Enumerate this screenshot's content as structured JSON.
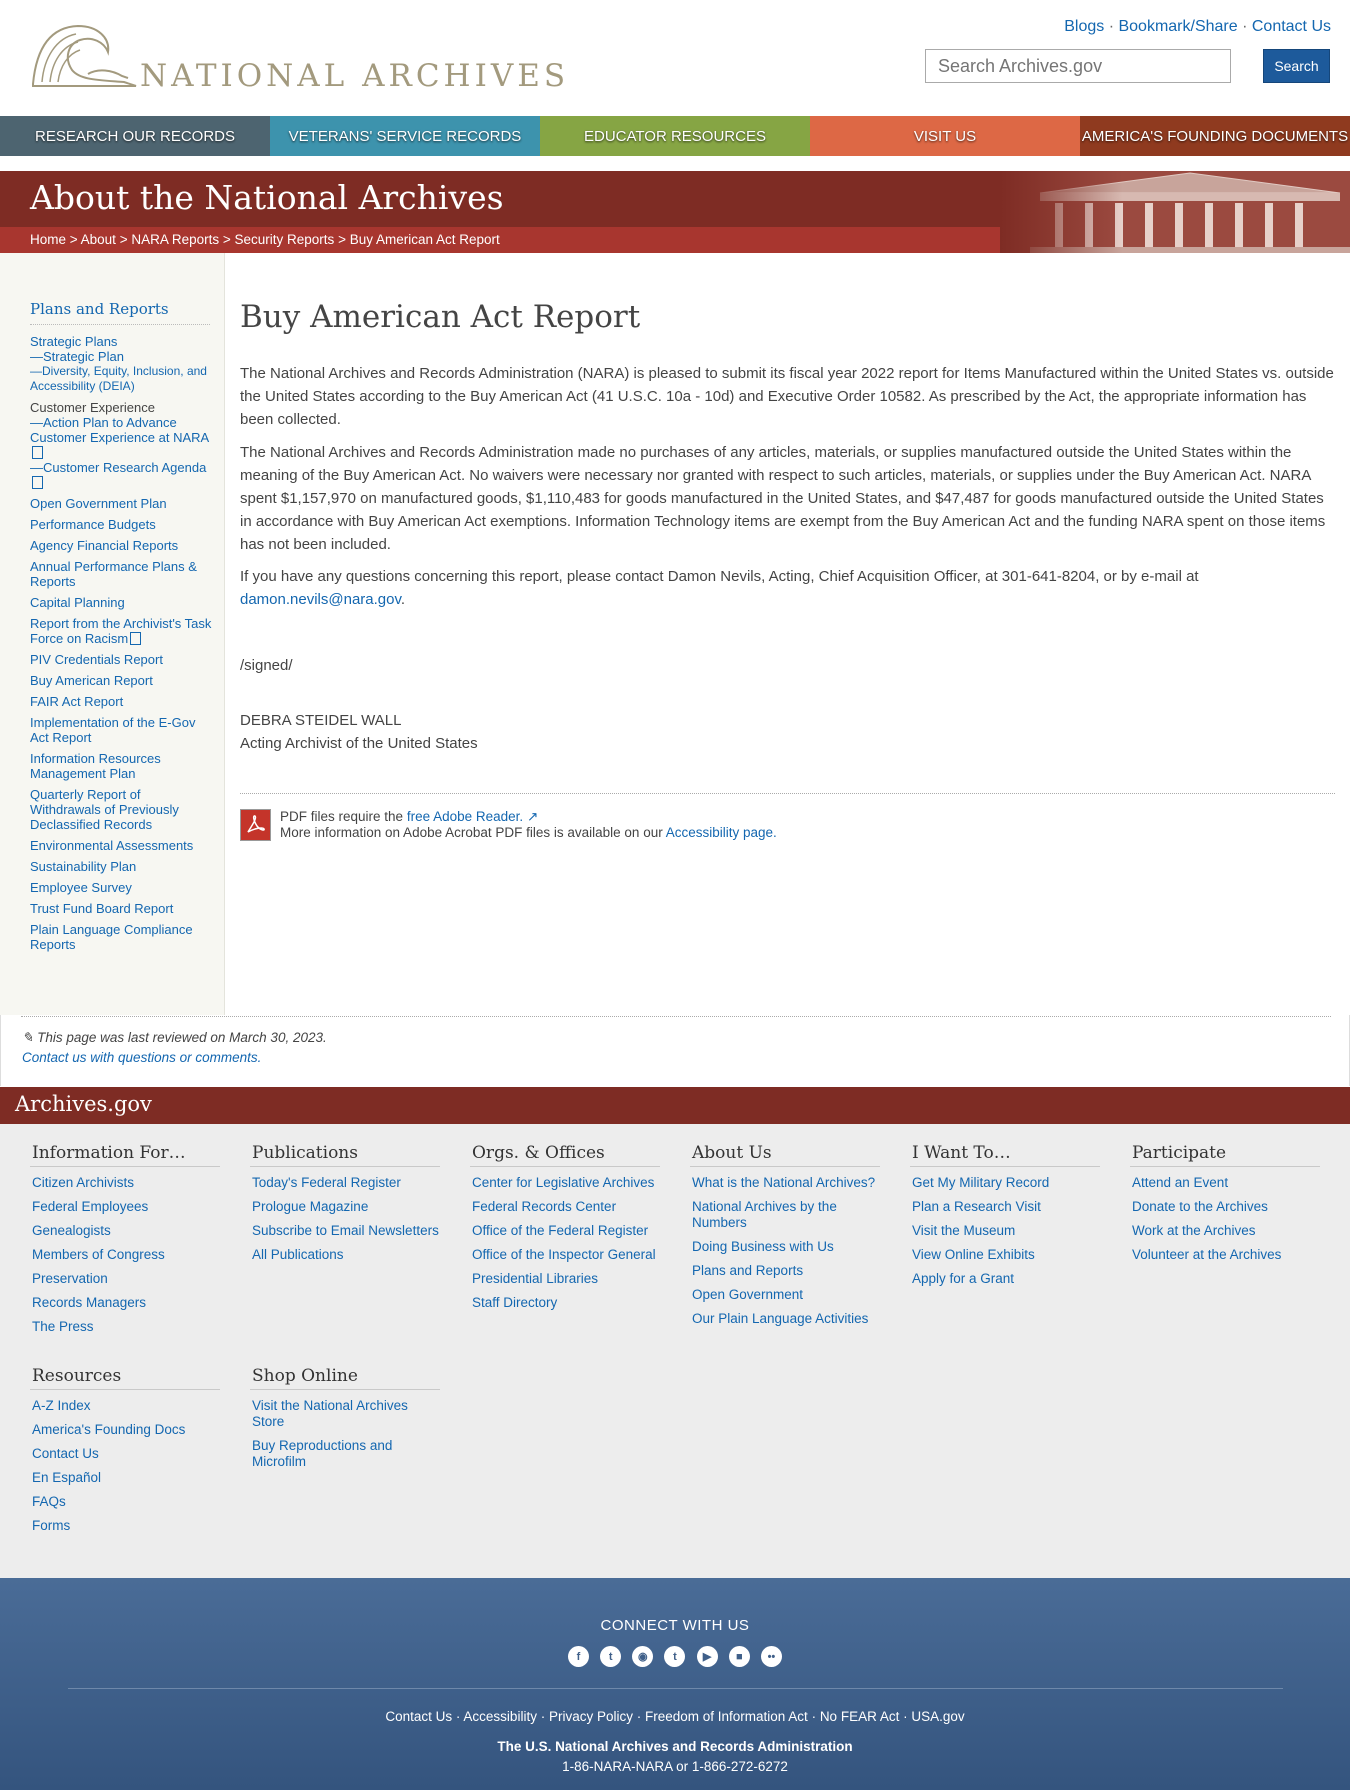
{
  "header": {
    "logo_text": "NATIONAL ARCHIVES",
    "top_links": [
      "Blogs",
      "Bookmark/Share",
      "Contact Us"
    ],
    "search_placeholder": "Search Archives.gov",
    "search_button": "Search"
  },
  "nav": [
    {
      "label": "RESEARCH OUR RECORDS",
      "color": "#4d6470"
    },
    {
      "label": "VETERANS' SERVICE RECORDS",
      "color": "#3d93ad"
    },
    {
      "label": "EDUCATOR RESOURCES",
      "color": "#86a544"
    },
    {
      "label": "VISIT US",
      "color": "#dd6845"
    },
    {
      "label": "AMERICA'S FOUNDING DOCUMENTS",
      "color": "#8f3a1f"
    }
  ],
  "banner": {
    "title": "About the National Archives",
    "breadcrumb": [
      "Home",
      "About",
      "NARA Reports",
      "Security Reports",
      "Buy American Act Report"
    ]
  },
  "sidebar": {
    "title": "Plans and Reports",
    "items": [
      "Strategic Plans",
      "—Strategic Plan",
      "—Diversity, Equity, Inclusion, and Accessibility (DEIA)",
      "Customer Experience",
      "—Action Plan to Advance Customer Experience at NARA",
      "—Customer Research Agenda",
      "Open Government Plan",
      "Performance Budgets",
      "Agency Financial Reports",
      "Annual Performance Plans & Reports",
      "Capital Planning",
      "Report from the Archivist's Task Force on Racism",
      "PIV Credentials Report",
      "Buy American Report",
      "FAIR Act Report",
      "Implementation of the E-Gov Act Report",
      "Information Resources Management Plan",
      "Quarterly Report of Withdrawals of Previously Declassified Records",
      "Environmental Assessments",
      "Sustainability Plan",
      "Employee Survey",
      "Trust Fund Board Report",
      "Plain Language Compliance Reports"
    ]
  },
  "main": {
    "title": "Buy American Act Report",
    "p1": "The National Archives and Records Administration (NARA) is pleased to submit its fiscal year 2022 report for Items Manufactured within the United States vs. outside the United States according to the Buy American Act (41 U.S.C. 10a - 10d) and Executive Order 10582. As prescribed by the Act, the appropriate information has been collected.",
    "p2": "The National Archives and Records Administration made no purchases of any articles, materials, or supplies manufactured outside the United States within the meaning of the Buy American Act. No waivers were necessary nor granted with respect to such articles, materials, or supplies under the Buy American Act. NARA spent $1,157,970 on manufactured goods, $1,110,483 for goods manufactured in the United States, and $47,487 for goods manufactured outside the United States in accordance with Buy American Act exemptions. Information Technology items are exempt from the Buy American Act and the funding NARA spent on those items has not been included.",
    "p3_text": "If you have any questions concerning this report, please contact Damon Nevils, Acting, Chief Acquisition Officer, at 301-641-8204, or by e-mail at",
    "p3_email": "damon.nevils@nara.gov",
    "signed": "/signed/",
    "signer_name": "DEBRA STEIDEL WALL",
    "signer_title": "Acting Archivist of the United States",
    "pdf_text_a": "PDF files require the",
    "pdf_link": "free Adobe Reader.",
    "pdf_text_b": "More information on Adobe Acrobat PDF files is available on our",
    "pdf_link2": "Accessibility page."
  },
  "reviewed": {
    "text": "This page was last reviewed on March 30, 2023.",
    "contact": "Contact us with questions or comments."
  },
  "footer": {
    "brand": "Archives.gov",
    "columns": [
      {
        "title": "Information For…",
        "links": [
          "Citizen Archivists",
          "Federal Employees",
          "Genealogists",
          "Members of Congress",
          "Preservation",
          "Records Managers",
          "The Press"
        ]
      },
      {
        "title": "Publications",
        "links": [
          "Today's Federal Register",
          "Prologue Magazine",
          "Subscribe to Email Newsletters",
          "All Publications"
        ]
      },
      {
        "title": "Orgs. & Offices",
        "links": [
          "Center for Legislative Archives",
          "Federal Records Center",
          "Office of the Federal Register",
          "Office of the Inspector General",
          "Presidential Libraries",
          "Staff Directory"
        ]
      },
      {
        "title": "About Us",
        "links": [
          "What is the National Archives?",
          "National Archives by the Numbers",
          "Doing Business with Us",
          "Plans and Reports",
          "Open Government",
          "Our Plain Language Activities"
        ]
      },
      {
        "title": "I Want To…",
        "links": [
          "Get My Military Record",
          "Plan a Research Visit",
          "Visit the Museum",
          "View Online Exhibits",
          "Apply for a Grant"
        ]
      },
      {
        "title": "Participate",
        "links": [
          "Attend an Event",
          "Donate to the Archives",
          "Work at the Archives",
          "Volunteer at the Archives"
        ]
      },
      {
        "title": "Resources",
        "links": [
          "A-Z Index",
          "America's Founding Docs",
          "Contact Us",
          "En Español",
          "FAQs",
          "Forms"
        ]
      },
      {
        "title": "Shop Online",
        "links": [
          "Visit the National Archives Store",
          "Buy Reproductions and Microfilm"
        ]
      }
    ],
    "connect_title": "CONNECT WITH US",
    "social": [
      "facebook-icon",
      "twitter-icon",
      "instagram-icon",
      "tumblr-icon",
      "youtube-icon",
      "blog-icon",
      "flickr-icon"
    ],
    "legal": [
      "Contact Us",
      "Accessibility",
      "Privacy Policy",
      "Freedom of Information Act",
      "No FEAR Act",
      "USA.gov"
    ],
    "agency": "The U.S. National Archives and Records Administration",
    "phone": "1-86-NARA-NARA or 1-866-272-6272"
  }
}
